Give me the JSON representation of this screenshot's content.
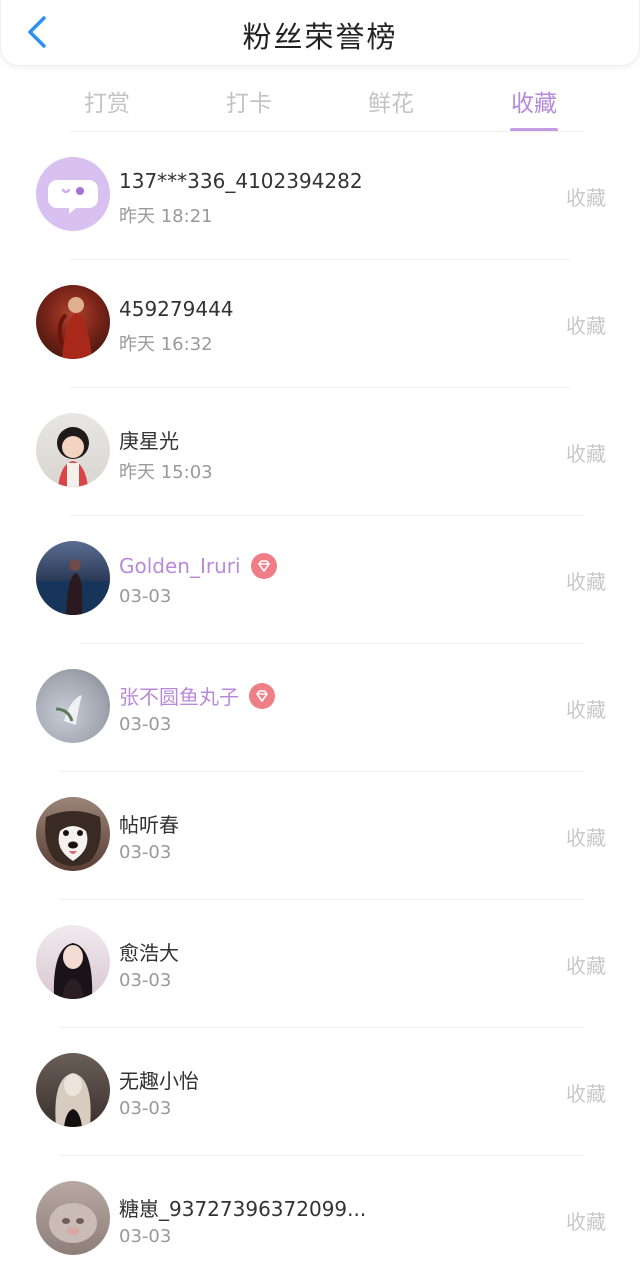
{
  "header": {
    "title": "粉丝荣誉榜"
  },
  "tabs": [
    {
      "label": "打赏"
    },
    {
      "label": "打卡"
    },
    {
      "label": "鲜花"
    },
    {
      "label": "收藏"
    }
  ],
  "active_tab": "收藏",
  "colors": {
    "accent": "#b58ad8",
    "vip_name": "#b98ad9",
    "vip_badge": "#f07e86",
    "back_arrow": "#2b8ef0"
  },
  "list": [
    {
      "name": "137***336_4102394282",
      "time": "昨天 18:21",
      "action": "收藏",
      "vip": false,
      "avatar": "chat-bubble-icon"
    },
    {
      "name": "459279444",
      "time": "昨天 16:32",
      "action": "收藏",
      "vip": false,
      "avatar": "photo"
    },
    {
      "name": "庚星光",
      "time": "昨天 15:03",
      "action": "收藏",
      "vip": false,
      "avatar": "photo"
    },
    {
      "name": "Golden_Iruri",
      "time": "03-03",
      "action": "收藏",
      "vip": true,
      "avatar": "photo"
    },
    {
      "name": "张不圆鱼丸子",
      "time": "03-03",
      "action": "收藏",
      "vip": true,
      "avatar": "photo"
    },
    {
      "name": "帖听春",
      "time": "03-03",
      "action": "收藏",
      "vip": false,
      "avatar": "photo"
    },
    {
      "name": "愈浩大",
      "time": "03-03",
      "action": "收藏",
      "vip": false,
      "avatar": "photo"
    },
    {
      "name": "无趣小怡",
      "time": "03-03",
      "action": "收藏",
      "vip": false,
      "avatar": "photo"
    },
    {
      "name": "糖崽_93727396372099...",
      "time": "03-03",
      "action": "收藏",
      "vip": false,
      "avatar": "photo"
    }
  ]
}
